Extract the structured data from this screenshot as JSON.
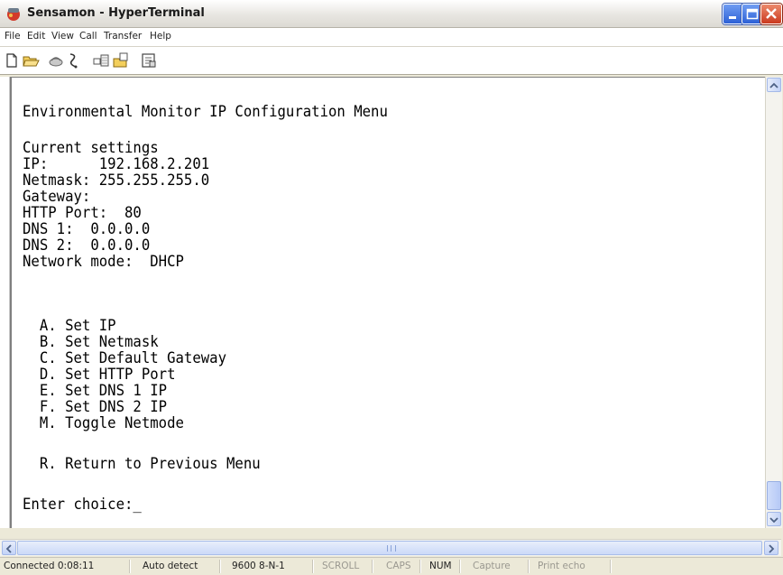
{
  "window": {
    "title": "Sensamon - HyperTerminal"
  },
  "menu": {
    "items": [
      "File",
      "Edit",
      "View",
      "Call",
      "Transfer",
      "Help"
    ]
  },
  "toolbar": {
    "buttons": [
      "new-icon",
      "open-icon",
      "connect-icon",
      "disconnect-icon",
      "send-icon",
      "receive-icon",
      "properties-icon"
    ]
  },
  "terminal": {
    "lines": [
      "Environmental Monitor IP Configuration Menu",
      "Current settings",
      "IP:      192.168.2.201",
      "Netmask: 255.255.255.0",
      "Gateway:",
      "HTTP Port:  80",
      "DNS 1:  0.0.0.0",
      "DNS 2:  0.0.0.0",
      "Network mode:  DHCP",
      "  A. Set IP",
      "  B. Set Netmask",
      "  C. Set Default Gateway",
      "  D. Set HTTP Port",
      "  E. Set DNS 1 IP",
      "  F. Set DNS 2 IP",
      "  M. Toggle Netmode",
      "  R. Return to Previous Menu",
      "Enter choice:_"
    ]
  },
  "statusbar": {
    "connected": "Connected 0:08:11",
    "detect": "Auto detect",
    "settings": "9600 8-N-1",
    "scroll": "SCROLL",
    "caps": "CAPS",
    "num": "NUM",
    "capture": "Capture",
    "print_echo": "Print echo"
  },
  "colors": {
    "title_gradient_top": "#ffffff",
    "close_button": "#cb3a1f",
    "minmax_button": "#2d61d6",
    "terminal_bg": "#ffffff",
    "terminal_text": "#000000"
  }
}
